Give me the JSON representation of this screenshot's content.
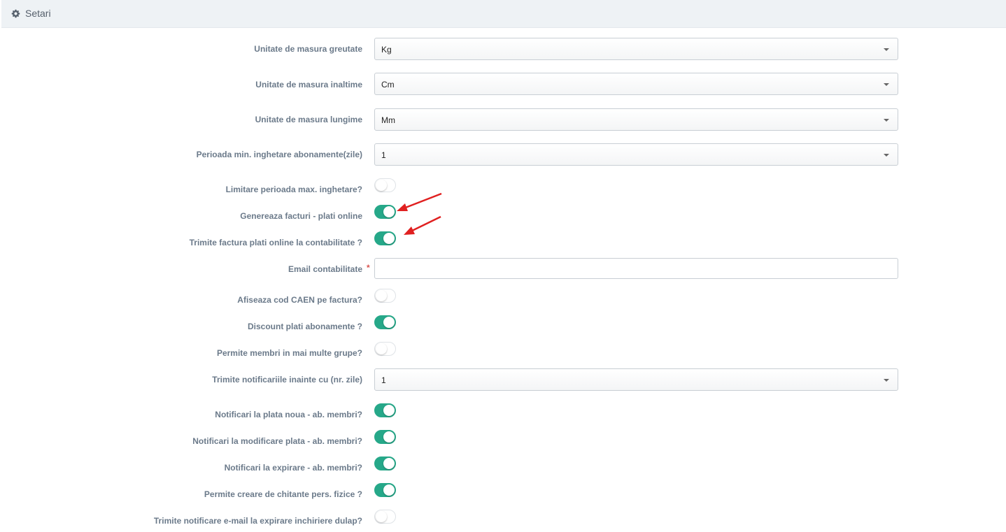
{
  "header": {
    "icon": "gear-icon",
    "title": "Setari"
  },
  "form": {
    "unit_weight": {
      "label": "Unitate de masura greutate",
      "value": "Kg"
    },
    "unit_height": {
      "label": "Unitate de masura inaltime",
      "value": "Cm"
    },
    "unit_length": {
      "label": "Unitate de masura lungime",
      "value": "Mm"
    },
    "freeze_min_period": {
      "label": "Perioada min. inghetare abonamente(zile)",
      "value": "1"
    },
    "freeze_max_limit": {
      "label": "Limitare perioada max. inghetare?",
      "checked": false
    },
    "generate_invoices_online": {
      "label": "Genereaza facturi - plati online",
      "checked": true
    },
    "send_invoice_accounting": {
      "label": "Trimite factura plati online la contabilitate ?",
      "checked": true
    },
    "accounting_email": {
      "label": "Email contabilitate",
      "required_mark": "*",
      "value": "",
      "placeholder": ""
    },
    "show_caen": {
      "label": "Afiseaza cod CAEN pe factura?",
      "checked": false
    },
    "discount_subscriptions": {
      "label": "Discount plati abonamente ?",
      "checked": true
    },
    "multi_groups": {
      "label": "Permite membri in mai multe grupe?",
      "checked": false
    },
    "notify_days_before": {
      "label": "Trimite notificariile inainte cu (nr. zile)",
      "value": "1"
    },
    "notify_new_payment": {
      "label": "Notificari la plata noua - ab. membri?",
      "checked": true
    },
    "notify_payment_change": {
      "label": "Notificari la modificare plata - ab. membri?",
      "checked": true
    },
    "notify_expiry": {
      "label": "Notificari la expirare - ab. membri?",
      "checked": true
    },
    "allow_receipts": {
      "label": "Permite creare de chitante pers. fizice ?",
      "checked": true
    },
    "locker_expiry_email": {
      "label": "Trimite notificare e-mail la expirare inchiriere dulap?",
      "checked": false
    }
  },
  "colors": {
    "toggle_on": "#26a889",
    "toggle_off_border": "#dfe3e7",
    "label": "#6b7a8a",
    "required": "#d9534f",
    "header_bg": "#eef2f5",
    "annotation_arrow": "#e02020"
  }
}
